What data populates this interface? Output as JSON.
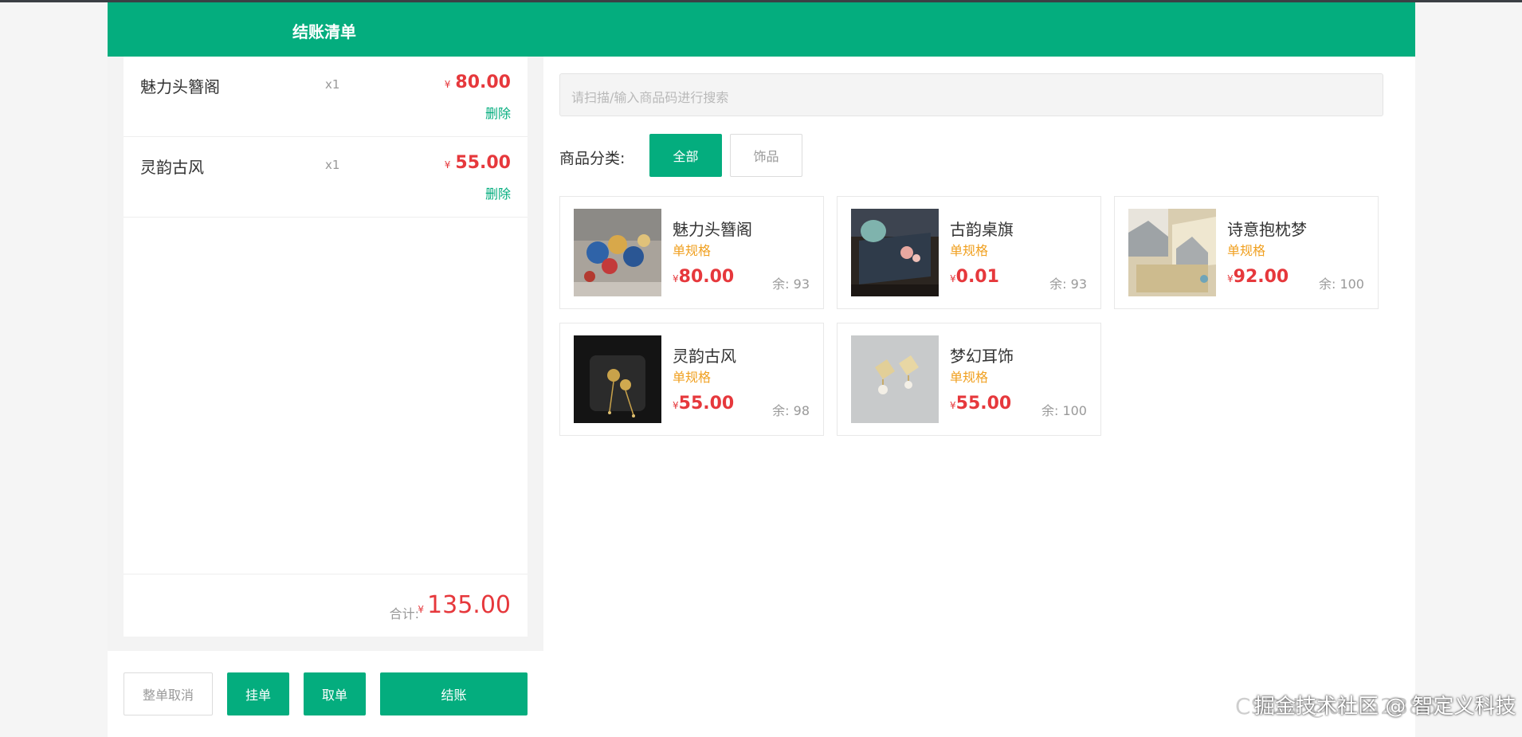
{
  "header": {
    "title": "结账清单"
  },
  "cart": {
    "currency": "¥",
    "items": [
      {
        "name": "魅力头簪阁",
        "qty": "x1",
        "price": "80.00",
        "delete_label": "删除"
      },
      {
        "name": "灵韵古风",
        "qty": "x1",
        "price": "55.00",
        "delete_label": "删除"
      }
    ],
    "total_label": "合计:",
    "total": "135.00"
  },
  "actions": {
    "cancel_all": "整单取消",
    "hang": "挂单",
    "take": "取单",
    "checkout": "结账"
  },
  "search": {
    "placeholder": "请扫描/输入商品码进行搜索"
  },
  "categories": {
    "label": "商品分类:",
    "items": [
      "全部",
      "饰品"
    ],
    "selected": "全部"
  },
  "products": [
    {
      "name": "魅力头簪阁",
      "spec": "单规格",
      "price": "80.00",
      "stock": "余: 93"
    },
    {
      "name": "古韵桌旗",
      "spec": "单规格",
      "price": "0.01",
      "stock": "余: 93"
    },
    {
      "name": "诗意抱枕梦",
      "spec": "单规格",
      "price": "92.00",
      "stock": "余: 100"
    },
    {
      "name": "灵韵古风",
      "spec": "单规格",
      "price": "55.00",
      "stock": "余: 98"
    },
    {
      "name": "梦幻耳饰",
      "spec": "单规格",
      "price": "55.00",
      "stock": "余: 100"
    }
  ],
  "watermark": {
    "text": "掘金技术社区 @ 智定义科技",
    "ghost_text": "CSDN @ultra23867"
  },
  "colors": {
    "accent": "#04ad7e",
    "price": "#e6383c",
    "spec": "#f0a020"
  }
}
